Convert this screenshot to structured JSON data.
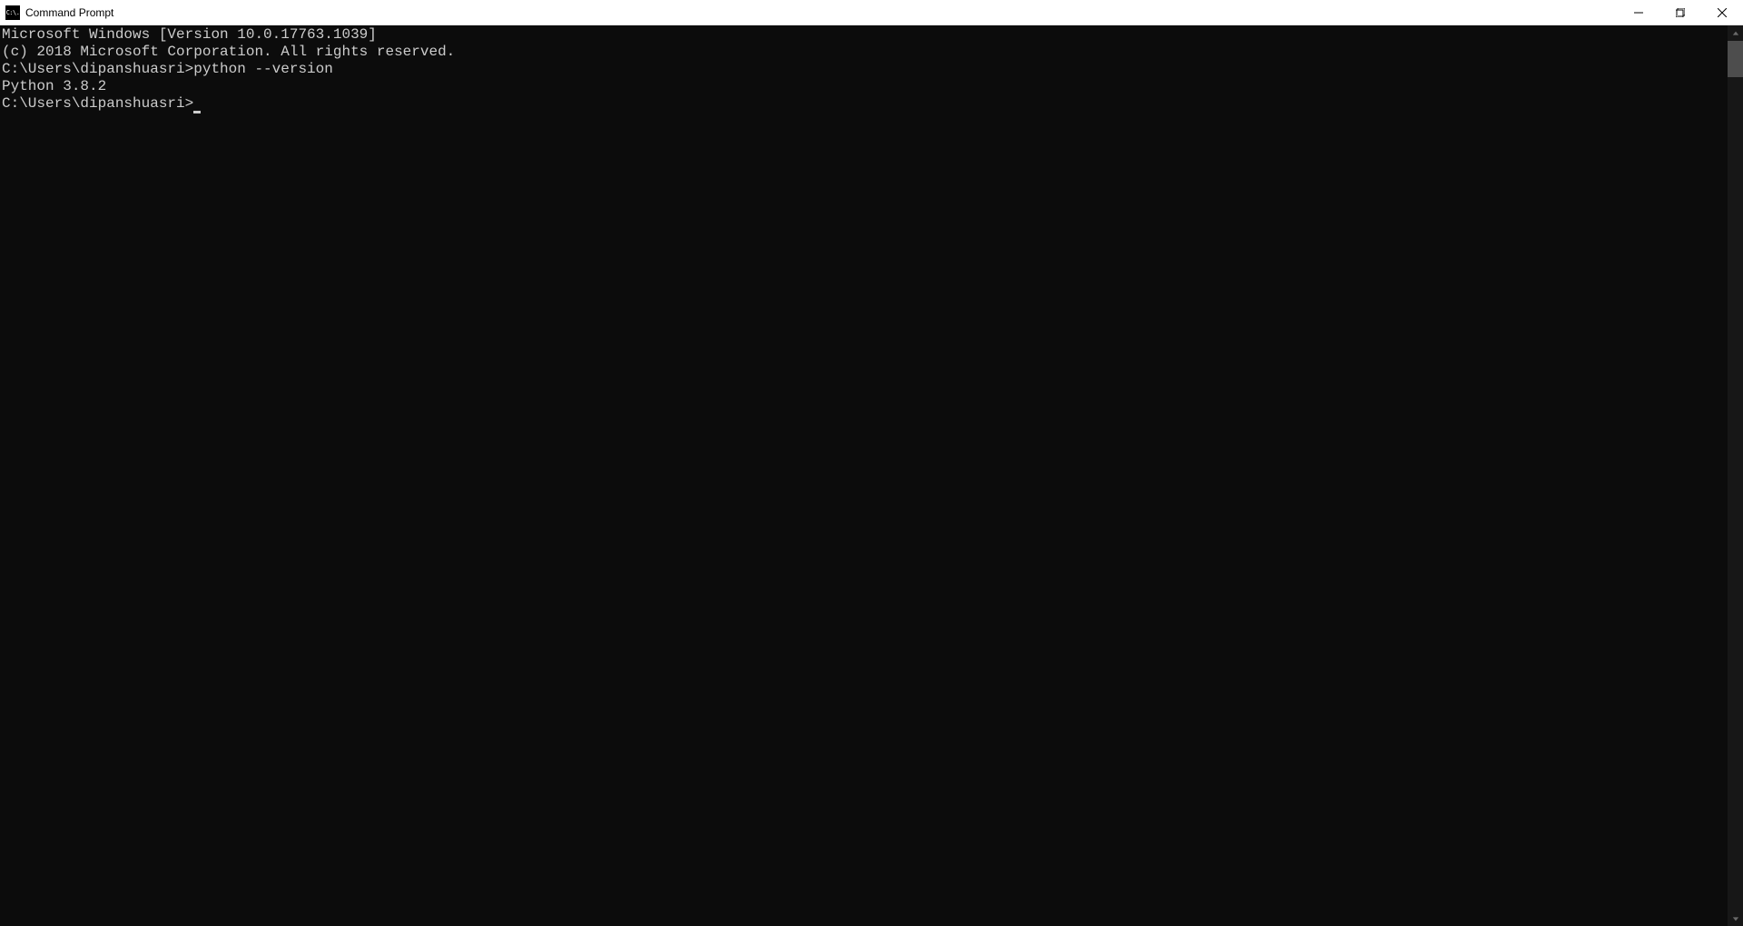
{
  "window": {
    "title": "Command Prompt",
    "icon_label": "C:\\."
  },
  "terminal": {
    "line1": "Microsoft Windows [Version 10.0.17763.1039]",
    "line2": "(c) 2018 Microsoft Corporation. All rights reserved.",
    "blank1": "",
    "prompt1": "C:\\Users\\dipanshuasri>",
    "command1": "python --version",
    "output1": "Python 3.8.2",
    "blank2": "",
    "prompt2": "C:\\Users\\dipanshuasri>"
  }
}
